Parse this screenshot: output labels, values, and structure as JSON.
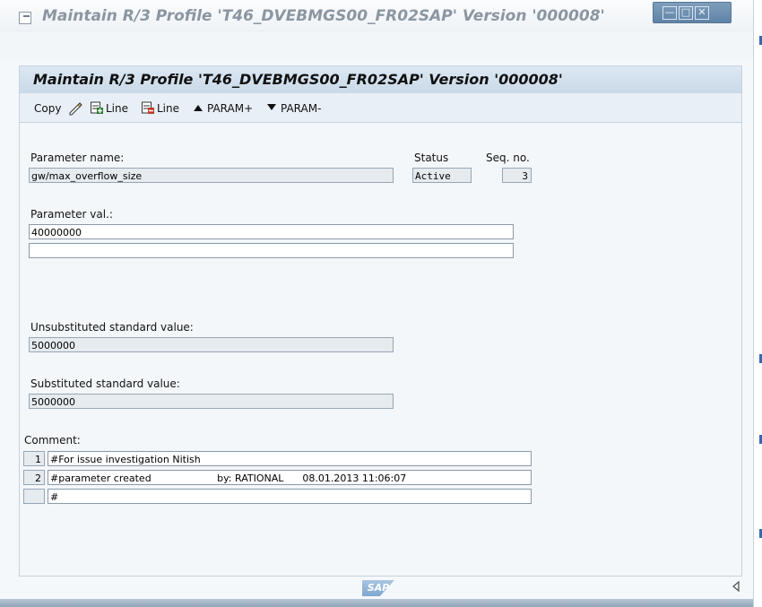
{
  "window": {
    "title": "Maintain R/3 Profile 'T46_DVEBMGS00_FR02SAP' Version '000008'",
    "controls": [
      "minimize",
      "maximize",
      "close"
    ]
  },
  "toolbar": {
    "command_field_value": "",
    "icons": [
      "enter-icon",
      "back-icon",
      "save-icon",
      "back-green-icon",
      "exit-icon",
      "cancel-icon",
      "print-icon",
      "find-icon",
      "find-next-icon",
      "first-page-icon",
      "previous-page-icon",
      "next-page-icon",
      "last-page-icon",
      "create-session-icon",
      "shortcut-icon",
      "help-icon",
      "customize-layout-icon"
    ]
  },
  "panel": {
    "title": "Maintain R/3 Profile 'T46_DVEBMGS00_FR02SAP' Version '000008'",
    "buttons": {
      "copy": "Copy",
      "insert_line": "Line",
      "delete_line": "Line",
      "param_plus": "PARAM+",
      "param_minus": "PARAM-"
    }
  },
  "form": {
    "param_name_label": "Parameter name:",
    "param_name_value": "gw/max_overflow_size",
    "status_label": "Status",
    "status_value": "Active",
    "seq_label": "Seq. no.",
    "seq_value": "3",
    "param_val_label": "Parameter val.:",
    "param_val_line1": "40000000",
    "param_val_line2": "",
    "unsub_label": "Unsubstituted standard value:",
    "unsub_value": "5000000",
    "sub_label": "Substituted standard value:",
    "sub_value": "5000000",
    "comment_label": "Comment:",
    "comments": [
      {
        "no": "1",
        "text": "#For issue investigation Nitish"
      },
      {
        "no": "2",
        "text": "#parameter created                     by: RATIONAL      08.01.2013 11:06:07"
      },
      {
        "no": "",
        "text": "#"
      }
    ]
  },
  "footer": {
    "logo": "SAP"
  }
}
